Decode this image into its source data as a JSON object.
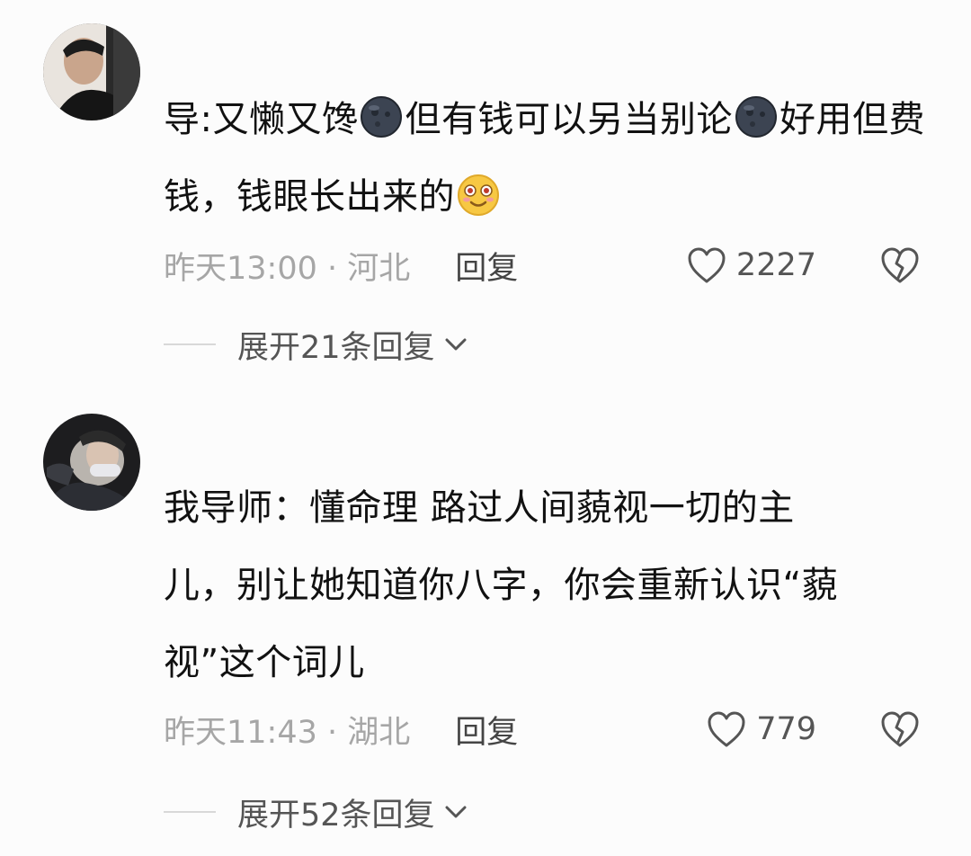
{
  "comments": [
    {
      "text_parts": [
        "导:又懒又馋",
        "但有钱可以另当别论",
        "好用但费钱，钱眼长出来的"
      ],
      "emojis": [
        "new-moon-face-emoji",
        "new-moon-face-emoji",
        "flushed-smile-emoji"
      ],
      "time_location": "昨天13:00 · 河北",
      "reply_label": "回复",
      "like_count": "2227",
      "expand_label": "展开21条回复"
    },
    {
      "text_line1": "我导师：懂命理 路过人间藐视一切的主",
      "text_line2": "儿，别让她知道你八字，你会重新认识“藐",
      "text_line3": "视”这个词儿",
      "time_location": "昨天11:43 · 湖北",
      "reply_label": "回复",
      "like_count": "779",
      "expand_label": "展开52条回复"
    }
  ],
  "icons": {
    "like": "heart-outline-icon",
    "dislike": "broken-heart-icon",
    "expand": "chevron-down-icon"
  }
}
